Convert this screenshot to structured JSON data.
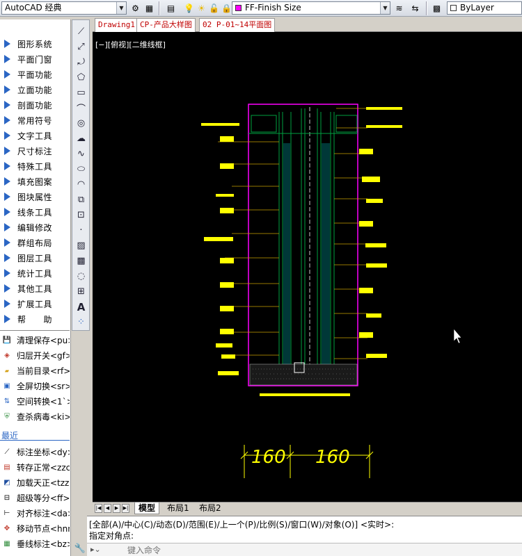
{
  "toolbar": {
    "workspace": "AutoCAD 经典",
    "layer": "FF-Finish Size",
    "color": "ByLayer",
    "icons": [
      "gear-icon",
      "workspace-icon",
      "layer-manager-icon",
      "lightbulb-icon",
      "sun-icon",
      "lock-icon",
      "layer-color-swatch",
      "match-layer-icon",
      "layer-previous-icon",
      "color-swatch"
    ]
  },
  "file_tabs": [
    "Drawing1",
    "CP-产品大样图",
    "02 P-01~14平面图"
  ],
  "view_label": "[−][俯视][二维线框]",
  "side_menu": [
    "图形系统",
    "平面门窗",
    "平面功能",
    "立面功能",
    "剖面功能",
    "常用符号",
    "文字工具",
    "尺寸标注",
    "特殊工具",
    "填充图案",
    "图块属性",
    "线条工具",
    "编辑修改",
    "群组布局",
    "图层工具",
    "统计工具",
    "其他工具",
    "扩展工具",
    "帮　　助"
  ],
  "commands": [
    {
      "icon": "save-icon",
      "label": "清理保存<pu>"
    },
    {
      "icon": "layers-icon",
      "label": "归层开关<gf>"
    },
    {
      "icon": "dwg-folder-icon",
      "label": "当前目录<rf>"
    },
    {
      "icon": "fullscreen-icon",
      "label": "全屏切换<sr>"
    },
    {
      "icon": "space-switch-icon",
      "label": "空间转换<1`>"
    },
    {
      "icon": "antivirus-icon",
      "label": "查杀病毒<ki>"
    }
  ],
  "recent_label": "最近",
  "recent_commands": [
    {
      "icon": "dimension-coord-icon",
      "label": "标注坐标<dy>"
    },
    {
      "icon": "save-as-icon",
      "label": "转存正常<zzc>"
    },
    {
      "icon": "load-icon",
      "label": "加载天正<tzz>"
    },
    {
      "icon": "equal-divide-icon",
      "label": "超级等分<ff>"
    },
    {
      "icon": "align-dim-icon",
      "label": "对齐标注<da>"
    },
    {
      "icon": "move-node-icon",
      "label": "移动节点<hnn>"
    },
    {
      "icon": "vertical-dim-icon",
      "label": "垂线标注<bz>"
    }
  ],
  "draw_tools": [
    "line-icon",
    "construction-line-icon",
    "polyline-icon",
    "polygon-icon",
    "rectangle-icon",
    "arc-icon",
    "circle-icon",
    "revcloud-icon",
    "spline-icon",
    "ellipse-icon",
    "ellipse-arc-icon",
    "insert-block-icon",
    "make-block-icon",
    "point-icon",
    "hatch-icon",
    "gradient-icon",
    "region-icon",
    "table-icon",
    "multiline-text-icon",
    "add-selected-icon"
  ],
  "drawing": {
    "dimensions": [
      "160",
      "160"
    ]
  },
  "layout_tabs": [
    "模型",
    "布局1",
    "布局2"
  ],
  "command_history": [
    "[全部(A)/中心(C)/动态(D)/范围(E)/上一个(P)/比例(S)/窗口(W)/对象(O)] <实时>:",
    "指定对角点:"
  ],
  "command_placeholder": "键入命令"
}
